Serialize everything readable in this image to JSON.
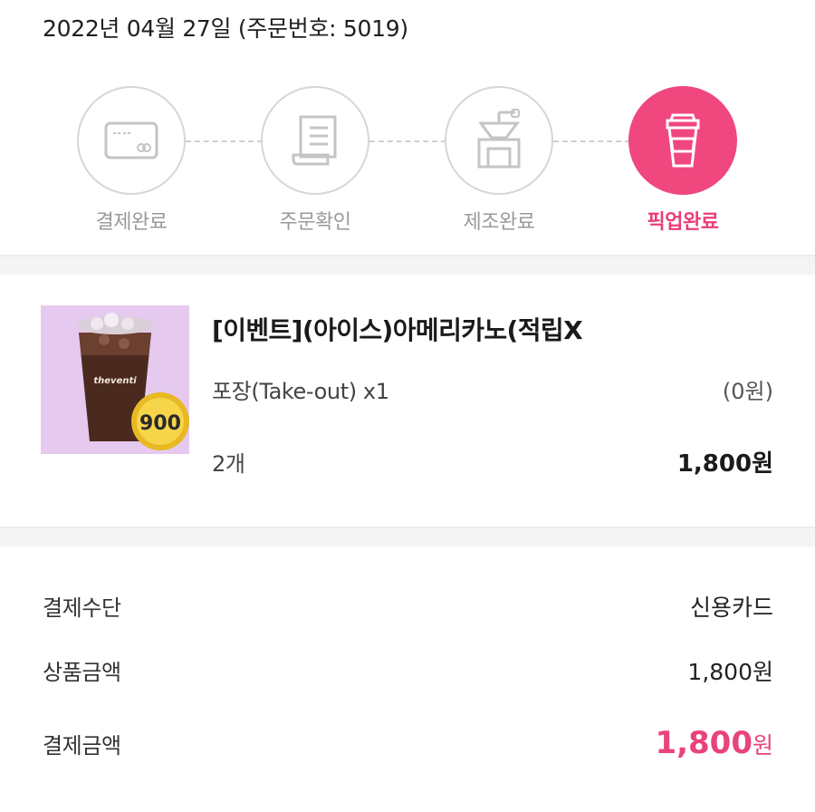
{
  "order_header": "2022년 04월 27일 (주문번호: 5019)",
  "steps": [
    {
      "label": "결제완료",
      "icon": "card-icon",
      "active": false
    },
    {
      "label": "주문확인",
      "icon": "receipt-icon",
      "active": false
    },
    {
      "label": "제조완료",
      "icon": "coffee-grinder-icon",
      "active": false
    },
    {
      "label": "픽업완료",
      "icon": "takeout-cup-icon",
      "active": true
    }
  ],
  "colors": {
    "accent": "#f0477f",
    "inactive": "#d6d6d6",
    "band": "#f4f4f4"
  },
  "product": {
    "title": "[이벤트](아이스)아메리카노(적립X",
    "option_label": "포장(Take-out) x1",
    "option_price": "(0원)",
    "quantity": "2개",
    "price": "1,800원",
    "thumbnail": {
      "brand_text": "theventi",
      "badge": "900"
    }
  },
  "payment": {
    "method_label": "결제수단",
    "method_value": "신용카드",
    "subtotal_label": "상품금액",
    "subtotal_value": "1,800원",
    "total_label": "결제금액",
    "total_amount": "1,800",
    "total_unit": "원"
  }
}
